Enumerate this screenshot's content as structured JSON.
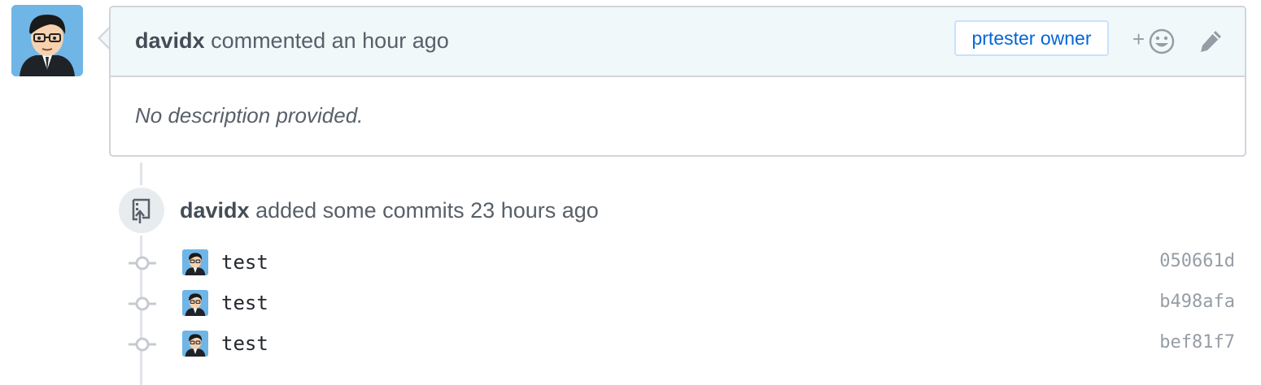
{
  "comment": {
    "author": "davidx",
    "action_text": "commented an hour ago",
    "badge": "prtester owner",
    "reaction_plus": "+",
    "body": "No description provided."
  },
  "event": {
    "author": "davidx",
    "text": "added some commits 23 hours ago"
  },
  "commits": [
    {
      "message": "test",
      "sha": "050661d"
    },
    {
      "message": "test",
      "sha": "b498afa"
    },
    {
      "message": "test",
      "sha": "bef81f7"
    }
  ],
  "colors": {
    "header_bg": "#f1f8fa",
    "border": "#d1d5da",
    "link_blue": "#0366d6",
    "muted": "#586069"
  },
  "icons": {
    "reaction": "smiley-icon",
    "edit": "pencil-icon",
    "event": "repo-push-icon",
    "commit": "git-commit-icon"
  }
}
